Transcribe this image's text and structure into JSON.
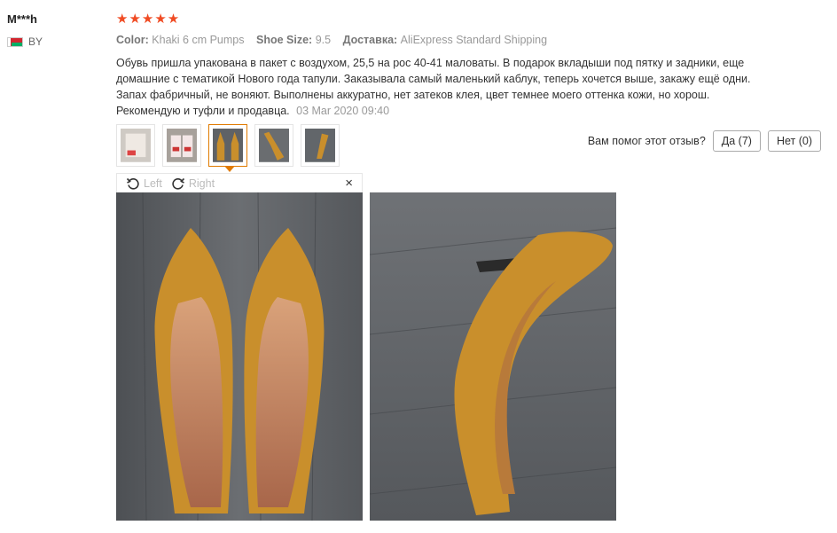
{
  "reviewer": {
    "name": "M***h",
    "country": "BY"
  },
  "rating": {
    "stars": "★★★★★",
    "value": 5
  },
  "meta": {
    "color_label": "Color:",
    "color_value": "Khaki 6 cm Pumps",
    "size_label": "Shoe Size:",
    "size_value": "9.5",
    "shipping_label": "Доставка:",
    "shipping_value": "AliExpress Standard Shipping"
  },
  "review": {
    "text": "Обувь пришла упакована в пакет с воздухом, 25,5 на рос 40-41 маловаты. В подарок вкладыши под пятку и задники, еще домашние с тематикой Нового года тапули. Заказывала самый маленький каблук, теперь хочется выше, закажу ещё одни. Запах фабричный, не воняют. Выполнены аккуратно, нет затеков клея, цвет темнее моего оттенка кожи, но хорош. Рекомендую и туфли и продавца.",
    "date": "03 Mar 2020 09:40"
  },
  "helpful": {
    "question": "Вам помог этот отзыв?",
    "yes_label": "Да (7)",
    "no_label": "Нет (0)"
  },
  "viewer": {
    "rotate_left": "Left",
    "rotate_right": "Right",
    "close": "×"
  },
  "thumbnails": [
    "thumb-1",
    "thumb-2",
    "thumb-3",
    "thumb-4",
    "thumb-5"
  ],
  "colors": {
    "stars": "#f04b23",
    "active_thumb": "#e07a00",
    "shoe": "#c98f2c",
    "floor": "#5a5d62"
  }
}
